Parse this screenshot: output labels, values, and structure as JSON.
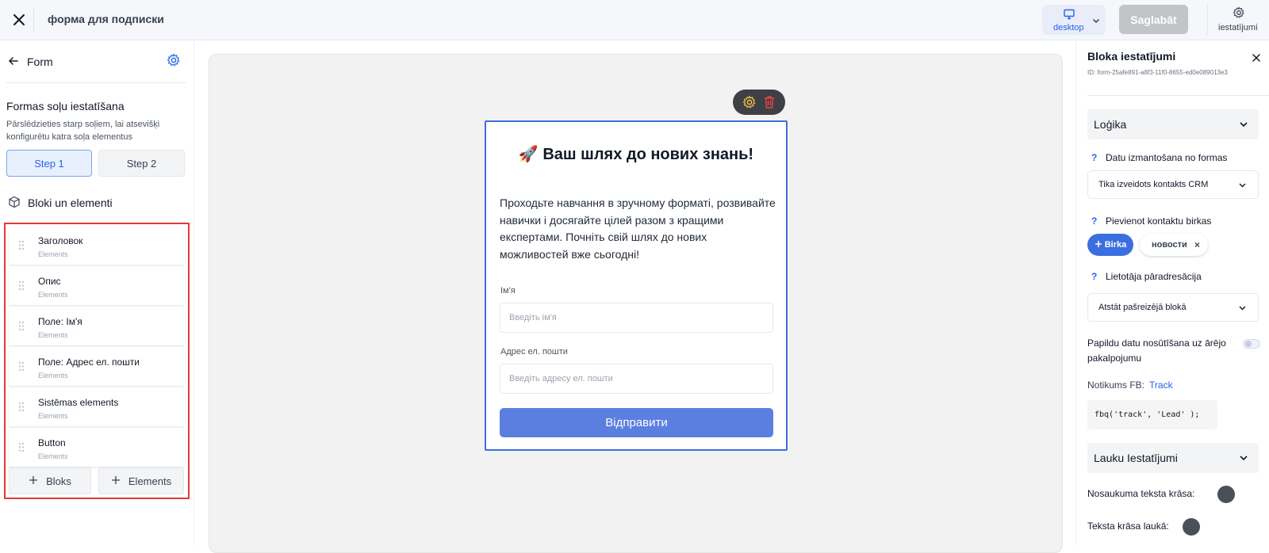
{
  "topbar": {
    "title": "форма для подписки",
    "device": {
      "label": "desktop",
      "icon": "monitor-icon"
    },
    "save_label": "Saglabāt",
    "settings_label": "iestatījumi"
  },
  "left_panel": {
    "header_title": "Form",
    "steps_title": "Formas soļu iestatīšana",
    "steps_desc": "Pārslēdzieties starp soļiem, lai atsevišķi konfigurētu katra soļa elementus",
    "steps": [
      {
        "label": "Step 1",
        "active": true
      },
      {
        "label": "Step 2",
        "active": false
      }
    ],
    "blocks_title": "Bloki un elementi",
    "blocks": [
      {
        "name": "Заголовок",
        "type": "Elements"
      },
      {
        "name": "Опис",
        "type": "Elements"
      },
      {
        "name": "Поле: Ім'я",
        "type": "Elements"
      },
      {
        "name": "Поле: Адрес ел. пошти",
        "type": "Elements"
      },
      {
        "name": "Sistēmas elements",
        "type": "Elements"
      },
      {
        "name": "Button",
        "type": "Elements"
      }
    ],
    "add_block_label": "Bloks",
    "add_element_label": "Elements"
  },
  "form": {
    "title": "🚀 Ваш шлях до нових знань!",
    "description": "Проходьте навчання в зручному форматі, розвивайте навички і досягайте цілей разом з кращими експертами. Почніть свій шлях до нових можливостей вже сьогодні!",
    "fields": [
      {
        "label": "Ім'я",
        "placeholder": "Введіть ім'я"
      },
      {
        "label": "Адрес ел. пошти",
        "placeholder": "Введіть адресу ел. пошти"
      }
    ],
    "submit_label": "Відправити"
  },
  "right_panel": {
    "title": "Bloka iestatījumi",
    "id_text": "ID: form-25afe891-a8f3-11f0-8655-ed0e089013e3",
    "logic_section": "Loģika",
    "data_usage_label": "Datu izmantošana no formas",
    "data_usage_value": "Tika izveidots kontakts CRM",
    "tags_label": "Pievienot kontaktu birkas",
    "tag_add_label": "Birka",
    "tags": [
      "новости"
    ],
    "redirect_label": "Lietotāja pāradresācija",
    "redirect_value": "Atstāt pašreizējā blokā",
    "external_send_label": "Papildu datu nosūtīšana uz ārējo pakalpojumu",
    "external_send_enabled": false,
    "fb_event_label": "Notikums FB:",
    "fb_event_value": "Track",
    "fb_code": "fbq('track', 'Lead' );",
    "fields_section": "Lauku Iestatījumi",
    "title_color_label": "Nosaukuma teksta krāsa:",
    "title_color": "#4b5058",
    "field_text_color_label": "Teksta krāsa laukā:",
    "field_text_color": "#4b5058"
  },
  "colors": {
    "accent": "#2563eb",
    "submit_button": "#5b7fe0",
    "highlight_border": "#e53935"
  }
}
